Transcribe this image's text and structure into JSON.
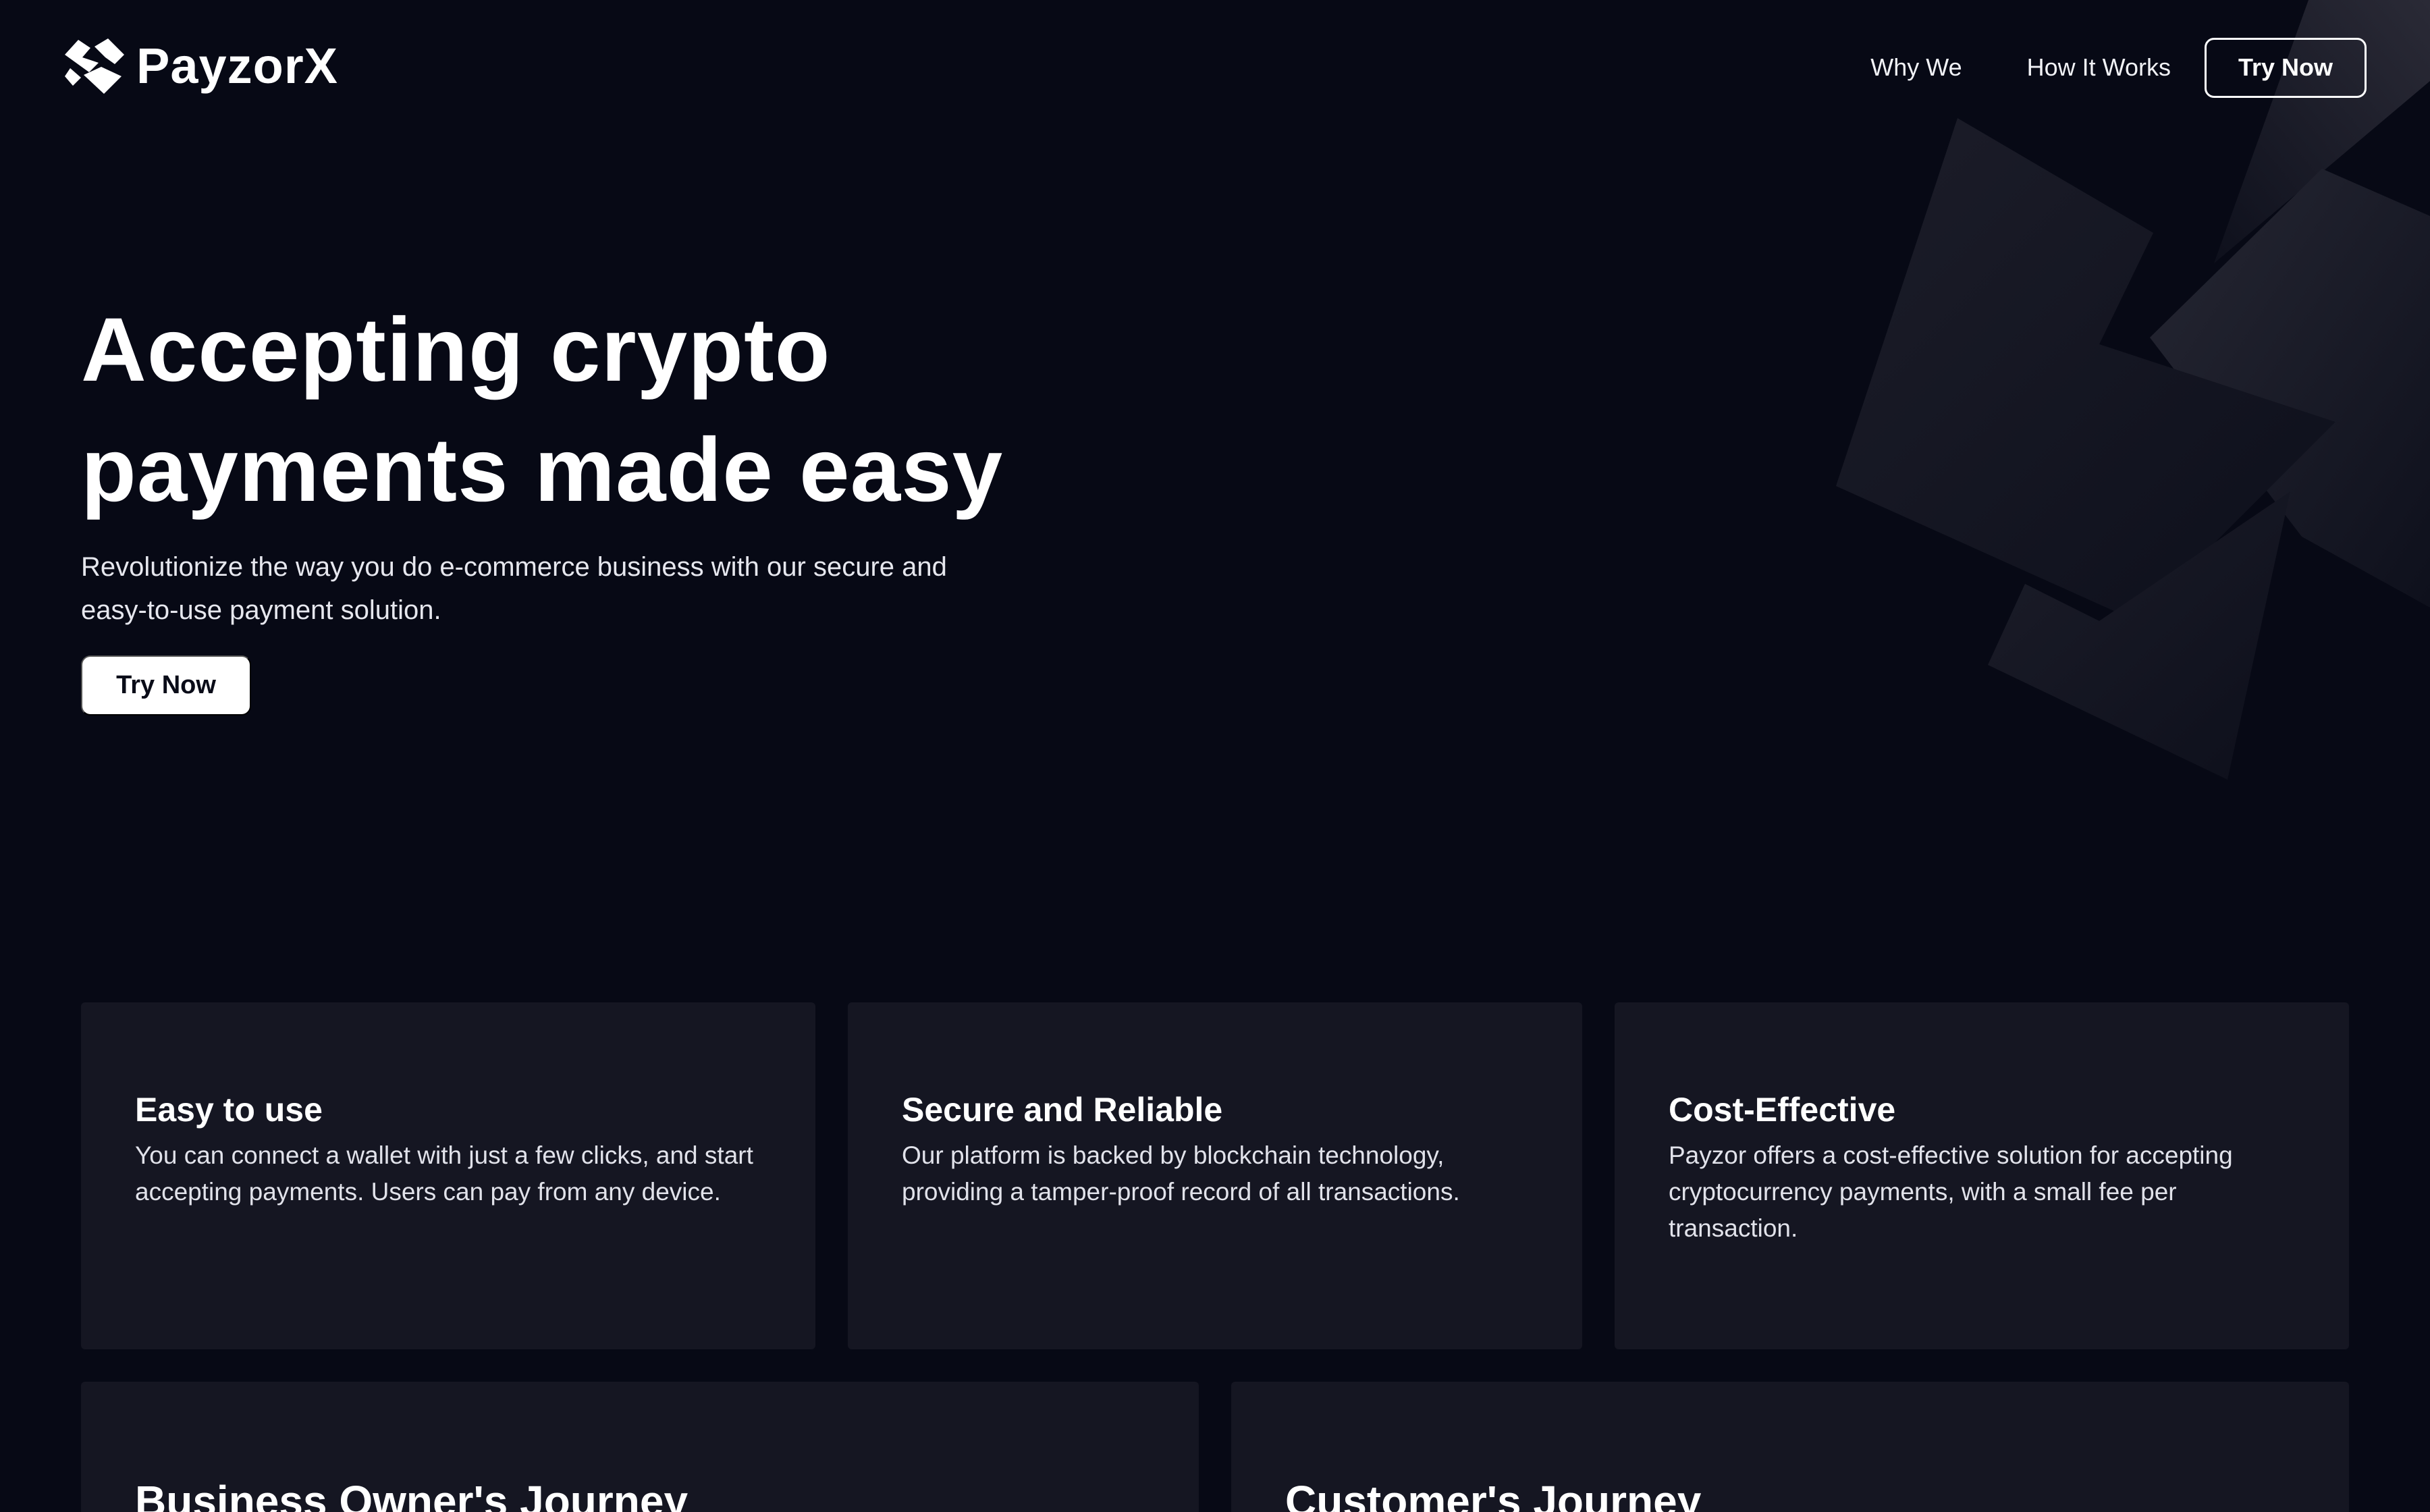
{
  "header": {
    "brand": "PayzorX",
    "nav": {
      "why_we": "Why We",
      "how_it_works": "How It Works",
      "try_now": "Try Now"
    }
  },
  "hero": {
    "title_line1": "Accepting crypto",
    "title_line2": "payments made easy",
    "subtitle": "Revolutionize the way you do e-commerce business with our secure and easy-to-use payment solution.",
    "cta": "Try Now"
  },
  "features": [
    {
      "title": "Easy to use",
      "text": "You can connect a wallet with just a few clicks, and start accepting payments. Users can pay from any device."
    },
    {
      "title": "Secure and Reliable",
      "text": "Our platform is backed by blockchain technology, providing a tamper-proof record of all transactions."
    },
    {
      "title": "Cost-Effective",
      "text": "Payzor offers a cost-effective solution for accepting cryptocurrency payments, with a small fee per transaction."
    }
  ],
  "journeys": [
    {
      "title": "Business Owner's Journey"
    },
    {
      "title": "Customer's Journey"
    }
  ],
  "colors": {
    "background": "#070915",
    "card": "#151622",
    "text": "#ffffff",
    "button_bg": "#ffffff",
    "button_text": "#0a0c18"
  },
  "icons": {
    "logo": "payzor-logo-icon",
    "hero_art": "payzor-mark-decoration"
  }
}
